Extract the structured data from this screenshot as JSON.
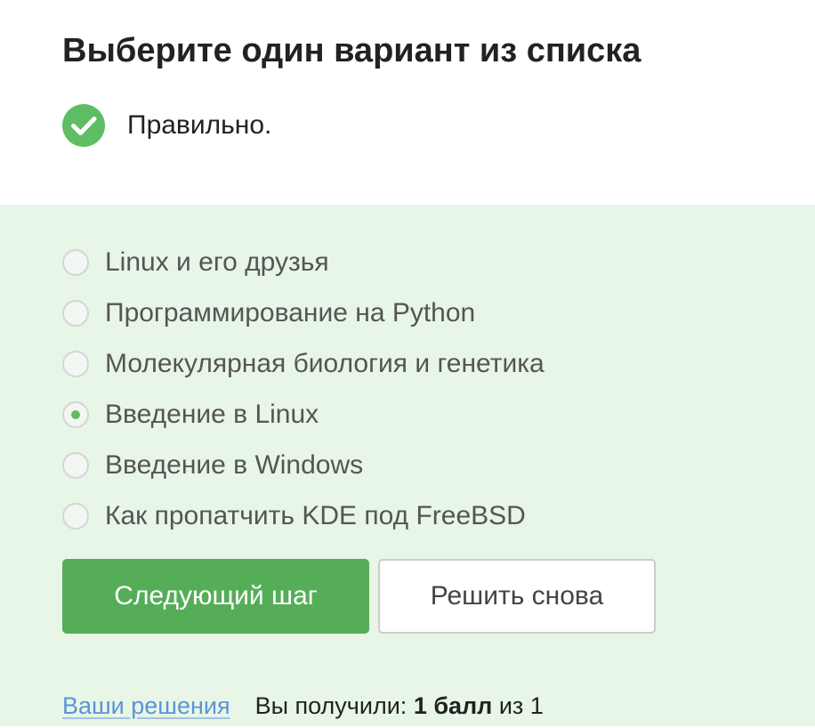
{
  "header": {
    "title": "Выберите один вариант из списка",
    "status_text": "Правильно.",
    "status_icon": "check-circle-icon",
    "status_color": "#5fbe63"
  },
  "options": [
    {
      "label": "Linux и его друзья",
      "selected": false
    },
    {
      "label": "Программирование на Python",
      "selected": false
    },
    {
      "label": "Молекулярная биология и генетика",
      "selected": false
    },
    {
      "label": "Введение в Linux",
      "selected": true
    },
    {
      "label": "Введение в Windows",
      "selected": false
    },
    {
      "label": "Как пропатчить KDE под FreeBSD",
      "selected": false
    }
  ],
  "buttons": {
    "next_label": "Следующий шаг",
    "retry_label": "Решить снова"
  },
  "footer": {
    "solutions_link": "Ваши решения",
    "score_prefix": "Вы получили:",
    "score_value": "1 балл",
    "score_suffix": "из 1"
  },
  "colors": {
    "accent_green": "#56ad58",
    "panel_background": "#e8f6e7",
    "link_blue": "#5b94d6"
  }
}
